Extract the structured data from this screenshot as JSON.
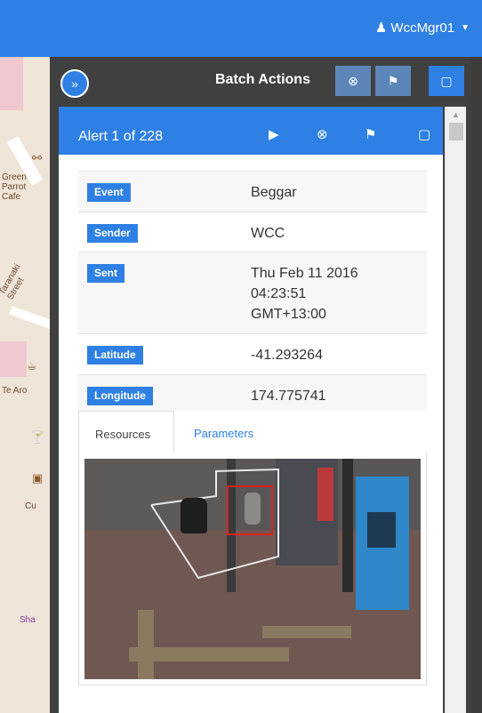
{
  "navbar": {
    "user": "WccMgr01"
  },
  "map": {
    "labels": [
      "Green",
      "Parrot",
      "Cafe",
      "Taranaki Street",
      "Te Aro",
      "Cu",
      "Sha"
    ]
  },
  "batch": {
    "label": "Batch Actions"
  },
  "alert": {
    "title": "Alert 1 of 228",
    "rows": [
      {
        "label": "Event",
        "value": "Beggar"
      },
      {
        "label": "Sender",
        "value": "WCC"
      },
      {
        "label": "Sent",
        "value": "Thu Feb 11 2016 04:23:51 GMT+13:00"
      },
      {
        "label": "Latitude",
        "value": "-41.293264"
      },
      {
        "label": "Longitude",
        "value": "174.775741"
      }
    ],
    "tabs": [
      {
        "label": "Resources",
        "active": true
      },
      {
        "label": "Parameters",
        "active": false
      }
    ]
  },
  "colors": {
    "primary": "#2f80e4"
  }
}
